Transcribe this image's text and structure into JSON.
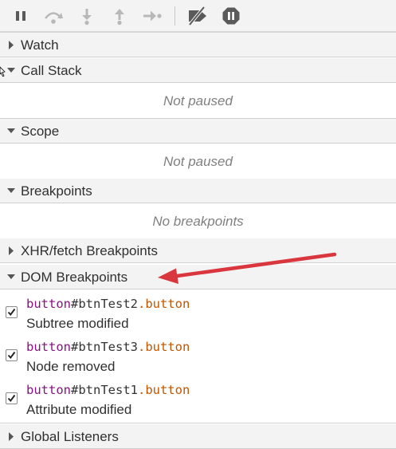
{
  "toolbar": {
    "buttons": [
      {
        "name": "pause-icon",
        "title": "Pause script execution"
      },
      {
        "name": "step-over-icon",
        "title": "Step over next function call"
      },
      {
        "name": "step-into-icon",
        "title": "Step into next function call"
      },
      {
        "name": "step-out-icon",
        "title": "Step out of current function"
      },
      {
        "name": "step-icon",
        "title": "Step"
      },
      {
        "name": "deactivate-breakpoints-icon",
        "title": "Deactivate breakpoints"
      },
      {
        "name": "pause-on-exceptions-icon",
        "title": "Pause on exceptions"
      }
    ]
  },
  "sections": {
    "watch": {
      "title": "Watch",
      "expanded": false
    },
    "call_stack": {
      "title": "Call Stack",
      "expanded": true,
      "empty_text": "Not paused"
    },
    "scope": {
      "title": "Scope",
      "expanded": true,
      "empty_text": "Not paused"
    },
    "breakpoints": {
      "title": "Breakpoints",
      "expanded": true,
      "empty_text": "No breakpoints"
    },
    "xhr": {
      "title": "XHR/fetch Breakpoints",
      "expanded": false
    },
    "dom": {
      "title": "DOM Breakpoints",
      "expanded": true,
      "items": [
        {
          "tag": "button",
          "id": "#btnTest2",
          "cls": ".button",
          "description": "Subtree modified",
          "checked": true
        },
        {
          "tag": "button",
          "id": "#btnTest3",
          "cls": ".button",
          "description": "Node removed",
          "checked": true
        },
        {
          "tag": "button",
          "id": "#btnTest1",
          "cls": ".button",
          "description": "Attribute modified",
          "checked": true
        }
      ]
    },
    "global": {
      "title": "Global Listeners",
      "expanded": false
    }
  },
  "colors": {
    "panel_bg": "#f3f3f3",
    "border": "#d0d0d0",
    "tag": "#881280",
    "class": "#c05600",
    "placeholder": "#808080",
    "annotation_arrow": "#d9363e"
  }
}
